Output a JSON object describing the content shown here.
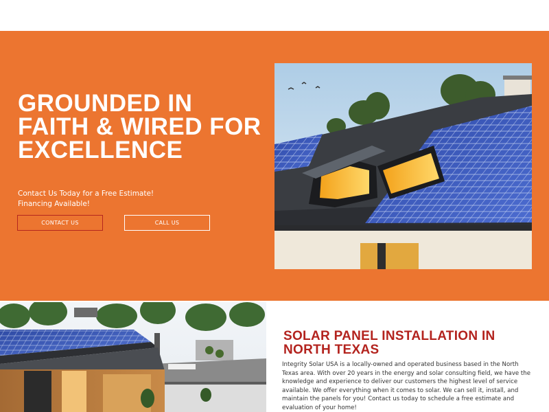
{
  "hero": {
    "title": "GROUNDED IN FAITH & WIRED FOR EXCELLENCE",
    "subtitle_line1": "Contact Us Today for a Free Estimate!",
    "subtitle_line2": "Financing Available!",
    "contact_button": "CONTACT US",
    "call_button": "CALL US",
    "background_color": "#ec7530"
  },
  "section": {
    "title": "SOLAR PANEL INSTALLATION IN NORTH TEXAS",
    "body": "Integrity Solar USA is a locally-owned and operated business based in the North Texas area. With over 20 years in the energy and solar consulting field, we have the knowledge and experience to deliver our customers the highest level of service available. We offer everything when it comes to solar. We can sell it, install, and maintain the panels for you! Contact us today to schedule a free estimate and evaluation of your home!",
    "title_color": "#b3231e"
  },
  "images": {
    "hero_photo": "house-roof-solar-panels-skylights-photo",
    "section_photo": "modern-house-rooftop-solar-terrace-photo"
  }
}
